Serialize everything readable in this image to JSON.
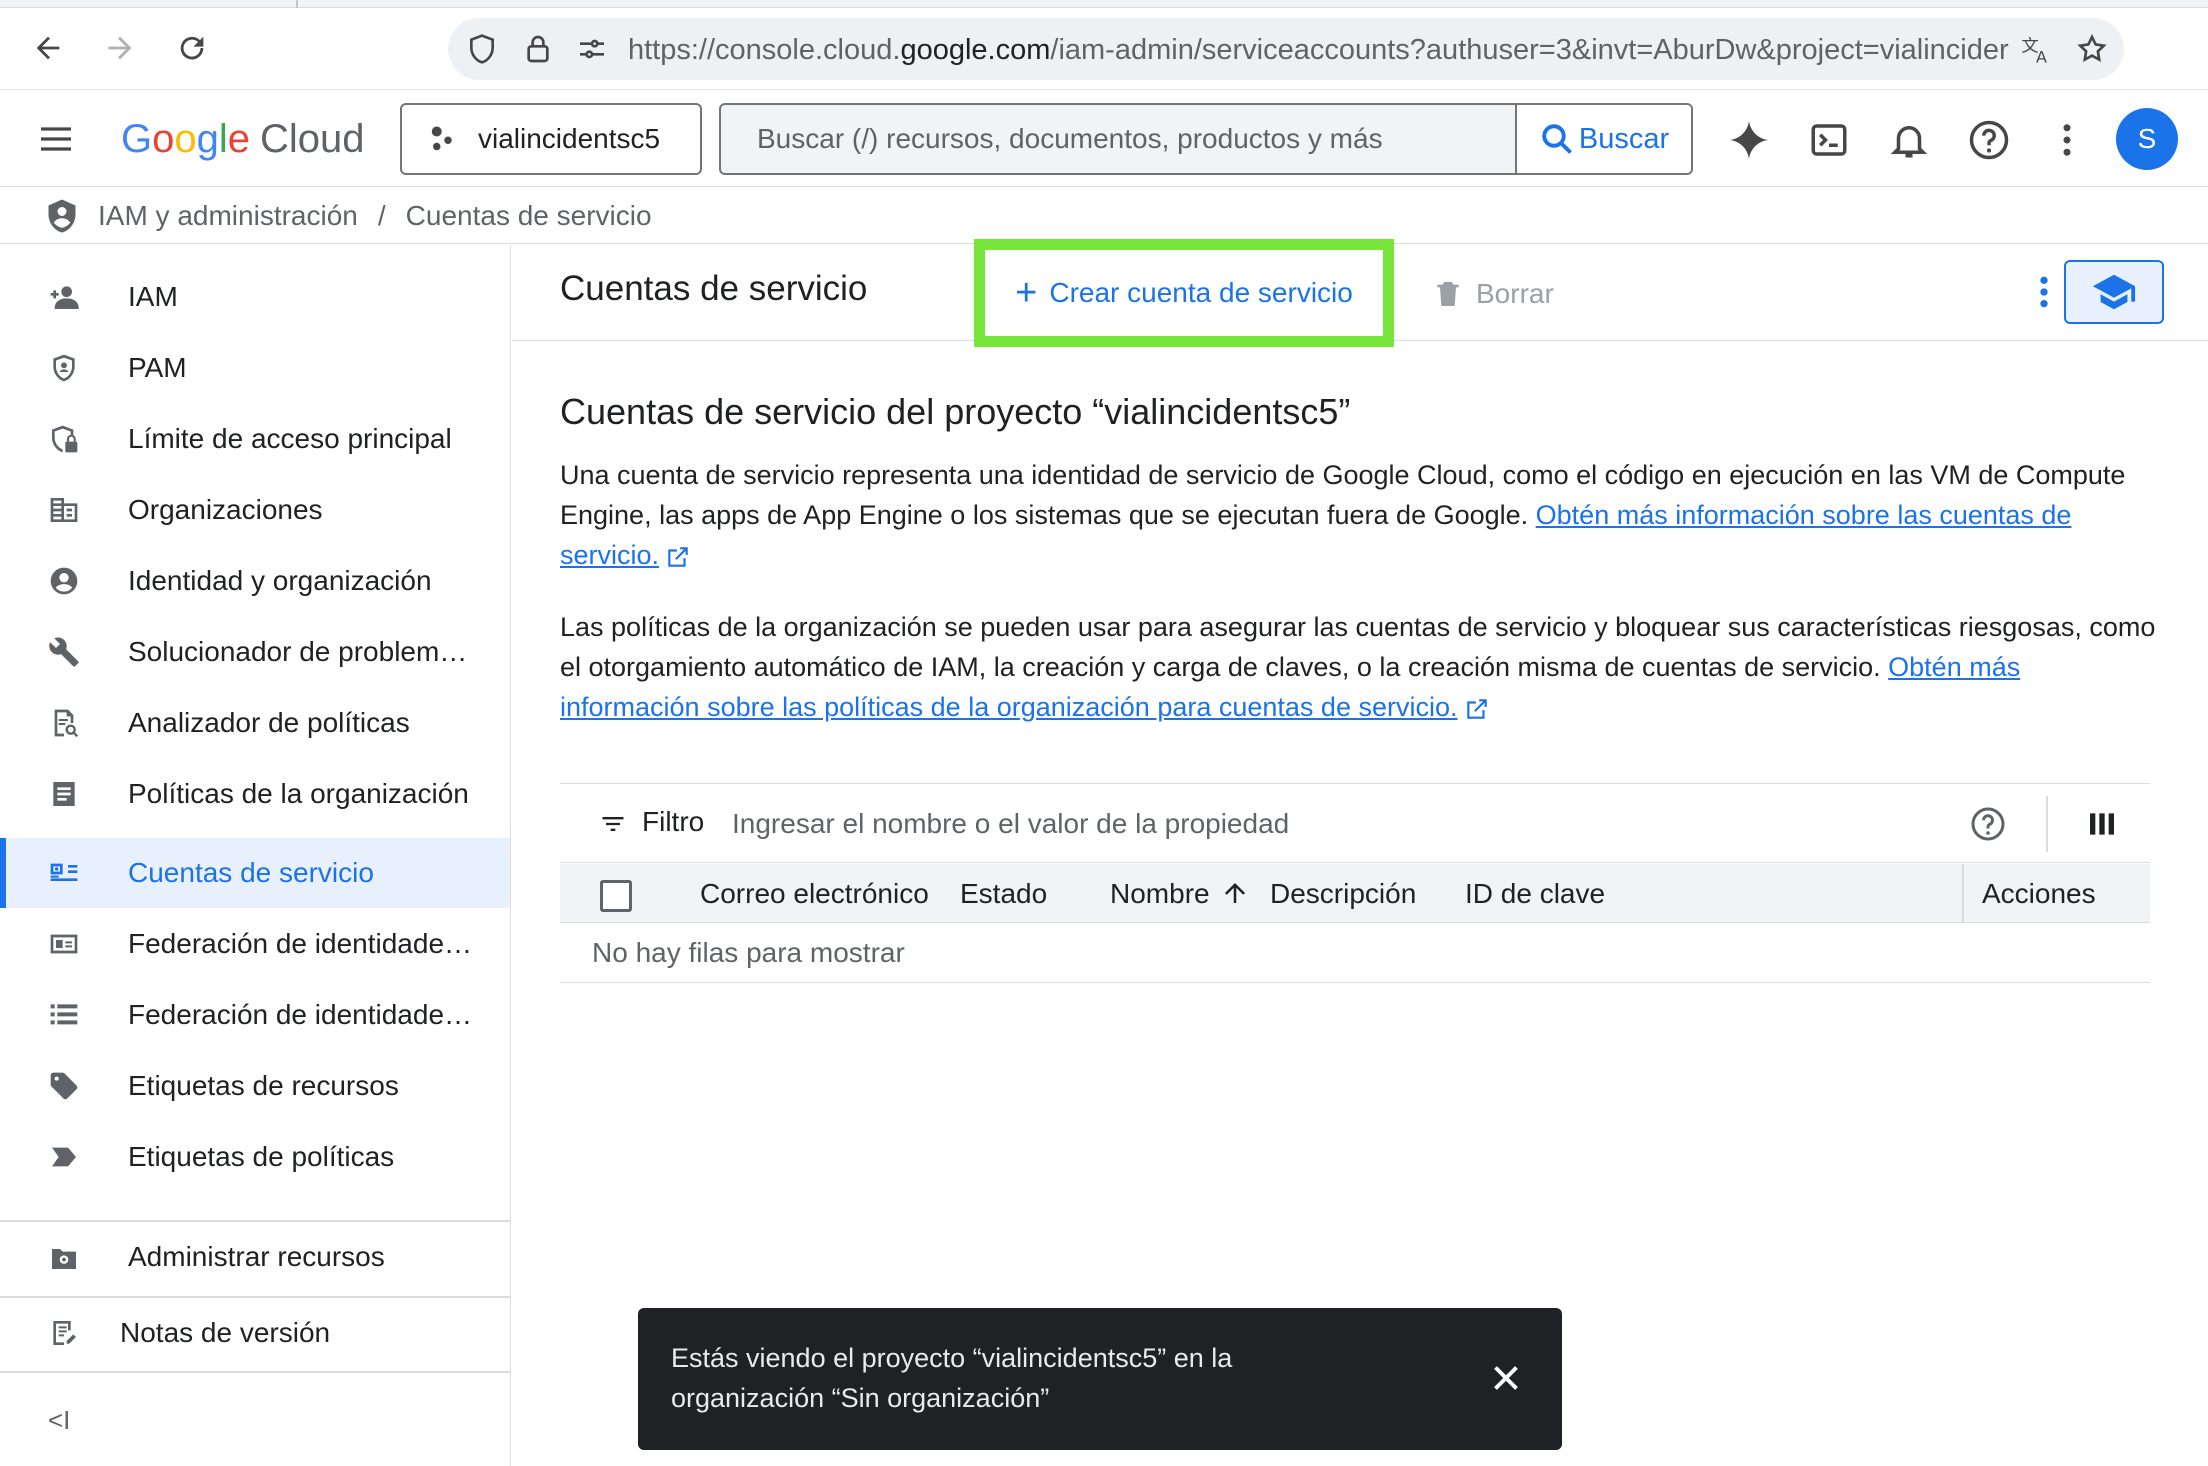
{
  "browser": {
    "url_prefix": "https://console.cloud.",
    "url_domain": "google.com",
    "url_path": "/iam-admin/serviceaccounts?authuser=3&invt=AburDw&project=vialincider"
  },
  "header": {
    "logo_letters": [
      "G",
      "o",
      "o",
      "g",
      "l",
      "e"
    ],
    "logo_cloud": "Cloud",
    "project_name": "vialincidentsc5",
    "search_placeholder": "Buscar (/) recursos, documentos, productos y más",
    "search_button": "Buscar",
    "avatar_letter": "S"
  },
  "breadcrumb": {
    "section": "IAM y administración",
    "separator": "/",
    "current": "Cuentas de servicio"
  },
  "sidebar": {
    "items": [
      {
        "label": "IAM",
        "icon": "person-add-icon"
      },
      {
        "label": "PAM",
        "icon": "shield-icon"
      },
      {
        "label": "Límite de acceso principal",
        "icon": "shield-lock-icon"
      },
      {
        "label": "Organizaciones",
        "icon": "building-icon"
      },
      {
        "label": "Identidad y organización",
        "icon": "account-circle-icon"
      },
      {
        "label": "Solucionador de problem…",
        "icon": "wrench-icon"
      },
      {
        "label": "Analizador de políticas",
        "icon": "document-search-icon"
      },
      {
        "label": "Políticas de la organización",
        "icon": "document-icon"
      },
      {
        "label": "Cuentas de servicio",
        "icon": "service-account-icon",
        "active": true
      },
      {
        "label": "Federación de identidade…",
        "icon": "id-card-icon"
      },
      {
        "label": "Federación de identidade…",
        "icon": "list-icon"
      },
      {
        "label": "Etiquetas de recursos",
        "icon": "tag-icon"
      },
      {
        "label": "Etiquetas de políticas",
        "icon": "label-arrow-icon"
      }
    ],
    "manage_resources": "Administrar recursos",
    "release_notes": "Notas de versión",
    "collapse": "<I"
  },
  "toolbar": {
    "title": "Cuentas de servicio",
    "create_button": "Crear cuenta de servicio",
    "delete_button": "Borrar"
  },
  "content": {
    "section_title": "Cuentas de servicio del proyecto “vialincidentsc5”",
    "para1_text": "Una cuenta de servicio representa una identidad de servicio de Google Cloud, como el código en ejecución en las VM de Compute Engine, las apps de App Engine o los sistemas que se ejecutan fuera de Google. ",
    "para1_link": "Obtén más información sobre las cuentas de servicio.",
    "para2_text": "Las políticas de la organización se pueden usar para asegurar las cuentas de servicio y bloquear sus características riesgosas, como el otorgamiento automático de IAM, la creación y carga de claves, o la creación misma de cuentas de servicio. ",
    "para2_link": "Obtén más información sobre las políticas de la organización para cuentas de servicio."
  },
  "table": {
    "filter_label": "Filtro",
    "filter_placeholder": "Ingresar el nombre o el valor de la propiedad",
    "columns": [
      "Correo electrónico",
      "Estado",
      "Nombre",
      "Descripción",
      "ID de clave",
      "Acciones"
    ],
    "empty_message": "No hay filas para mostrar"
  },
  "snackbar": {
    "message": "Estás viendo el proyecto “vialincidentsc5” en la organización “Sin organización”"
  },
  "colors": {
    "accent": "#1a73e8",
    "highlight": "#76e43a",
    "active_bg": "#e8f0fe"
  }
}
